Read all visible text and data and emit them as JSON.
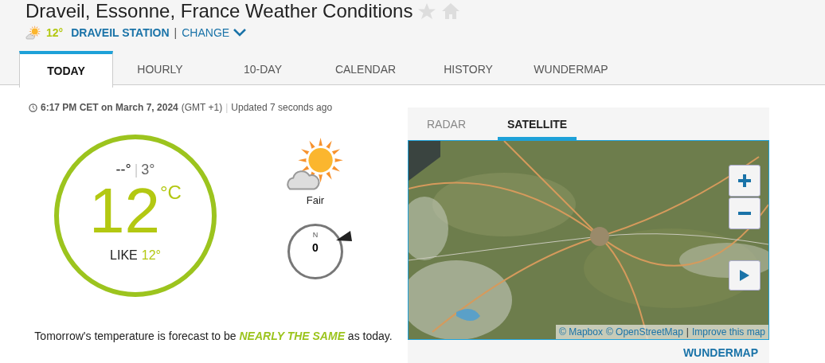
{
  "header": {
    "title": "Draveil, Essonne, France Weather Conditions",
    "favorite": false,
    "station_temp": "12°",
    "station": "DRAVEIL STATION",
    "separator": "|",
    "change": "CHANGE"
  },
  "tabs": [
    {
      "label": "TODAY",
      "selected": true
    },
    {
      "label": "HOURLY",
      "selected": false
    },
    {
      "label": "10-DAY",
      "selected": false
    },
    {
      "label": "CALENDAR",
      "selected": false
    },
    {
      "label": "HISTORY",
      "selected": false
    },
    {
      "label": "WUNDERMAP",
      "selected": false
    }
  ],
  "observation": {
    "time": "6:17 PM CET on March 7, 2024",
    "zone": "(GMT +1)",
    "separator": "|",
    "updated": "Updated 7 seconds ago"
  },
  "current": {
    "high": "--°",
    "divider": "|",
    "low": "3°",
    "temp": "12",
    "unit": "°C",
    "like_label": "LIKE",
    "like_value": "12°",
    "condition": "Fair",
    "wind_dir": "N",
    "wind_speed": "0"
  },
  "forecast": "Tomorrow's temperature is forecast to be *NEARLY THE SAME* as today.",
  "map_panel": {
    "tabs": [
      {
        "label": "RADAR",
        "selected": false
      },
      {
        "label": "SATELLITE",
        "selected": true
      }
    ],
    "attribution": [
      {
        "text": "© Mapbox"
      },
      {
        "text": "© OpenStreetMap"
      },
      {
        "text": "|",
        "kind": "separator"
      },
      {
        "text": "Improve this map"
      }
    ],
    "link": "WUNDERMAP"
  }
}
